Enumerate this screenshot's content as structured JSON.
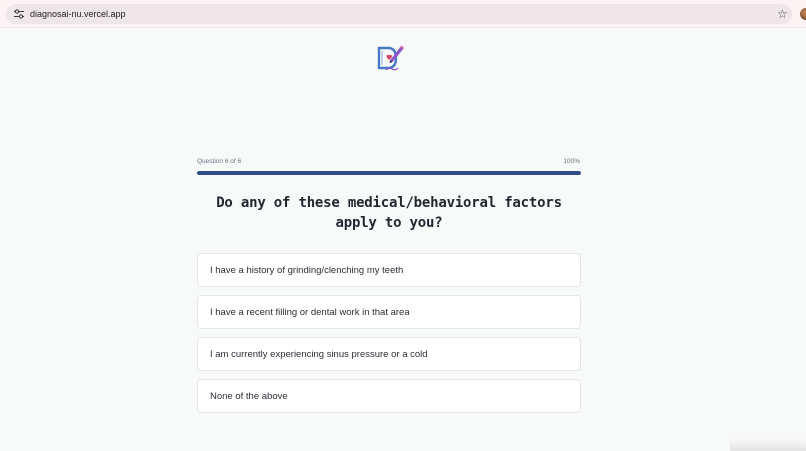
{
  "browser": {
    "url": "diagnosai-nu.vercel.app",
    "icons": {
      "site_settings": "tune-icon",
      "bookmark": "star-icon",
      "profile": "avatar"
    }
  },
  "app": {
    "logo": "diagnosai-logo"
  },
  "quiz": {
    "progress_label": "Question 6 of 6",
    "progress_percent": "100%",
    "progress_value": 1.0,
    "question": "Do any of these medical/behavioral factors apply to you?",
    "options": [
      "I have a history of grinding/clenching my teeth",
      "I have a recent filling or dental work in that area",
      "I am currently experiencing sinus pressure or a cold",
      "None of the above"
    ]
  },
  "colors": {
    "progress_fill": "#2f4f86",
    "progress_track": "#dde4ee",
    "background": "#f8faf9"
  }
}
